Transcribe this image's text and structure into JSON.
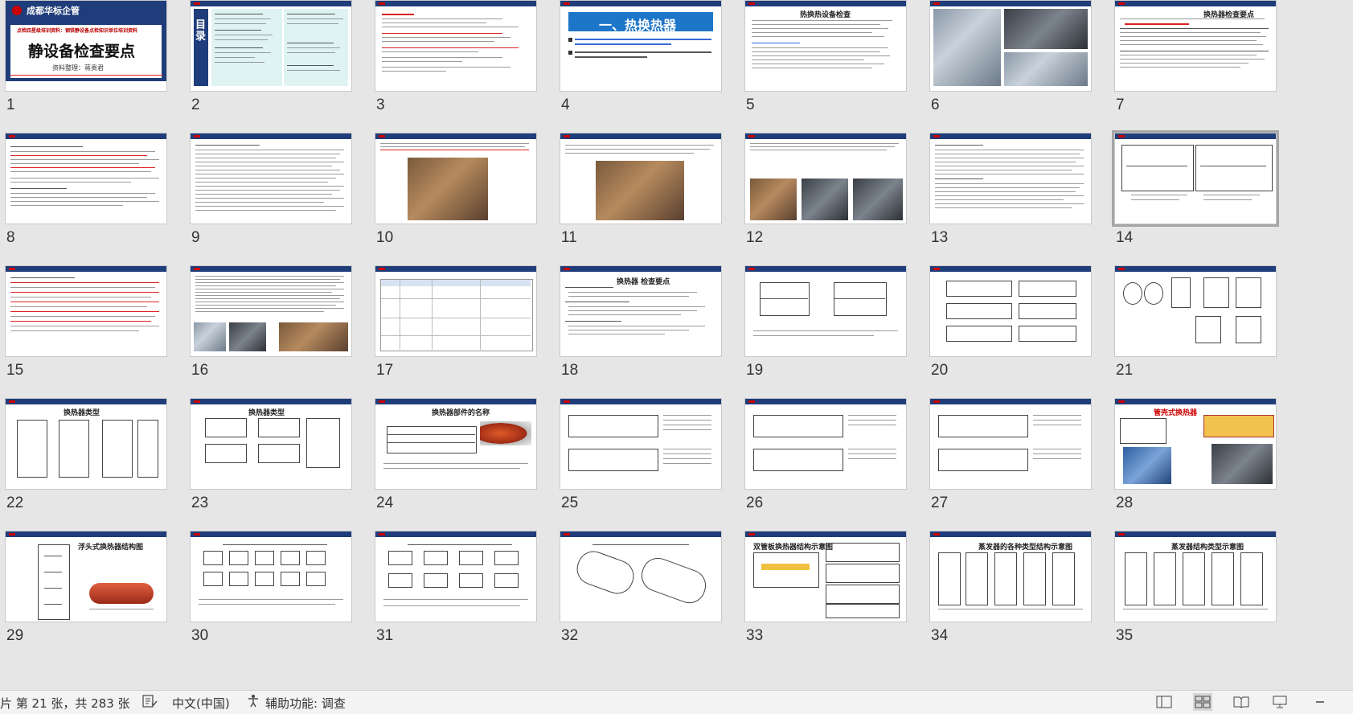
{
  "slides": {
    "s1": {
      "brand": "成都华标企管",
      "title": "静设备检查要点",
      "author": "资料整理：蒋贵君",
      "subtitle": "点检四星级培训资料：钢铁静设备点检知识单位培训资料"
    },
    "s2": {
      "title": "目录"
    },
    "s4": {
      "title": "一、热换热器"
    },
    "s5": {
      "title": "热换热设备检查"
    },
    "s7": {
      "title": "换热器检查要点"
    },
    "s18": {
      "title": "换热器 检查要点"
    },
    "s22": {
      "title": "换热器类型"
    },
    "s23": {
      "title": "换热器类型"
    },
    "s24": {
      "title": "换热器部件的名称"
    },
    "s28": {
      "title": "管壳式换热器"
    },
    "s29": {
      "title": "浮头式换热器结构图"
    },
    "s33": {
      "title": "双管板换热器结构示意图"
    },
    "s34": {
      "title": "蒸发器的各种类型结构示意图"
    },
    "s35": {
      "title": "蒸发器结构类型示意图"
    },
    "numbers": [
      "1",
      "2",
      "3",
      "4",
      "5",
      "6",
      "7",
      "8",
      "9",
      "10",
      "11",
      "12",
      "13",
      "14",
      "15",
      "16",
      "17",
      "18",
      "19",
      "20",
      "21",
      "22",
      "23",
      "24",
      "25",
      "26",
      "27",
      "28",
      "29",
      "30",
      "31",
      "32",
      "33",
      "34",
      "35"
    ]
  },
  "status": {
    "slide_info": "片 第 21 张，共 283 张",
    "language": "中文(中国)",
    "accessibility": "辅助功能: 调查"
  },
  "colors": {
    "header": "#1f3d7a",
    "accent": "#c00000",
    "selection": "#a6a6a6"
  },
  "icons": [
    "notes-spellcheck-icon",
    "accessibility-icon",
    "normal-view-icon",
    "slide-sorter-icon",
    "reading-view-icon",
    "slideshow-icon"
  ]
}
